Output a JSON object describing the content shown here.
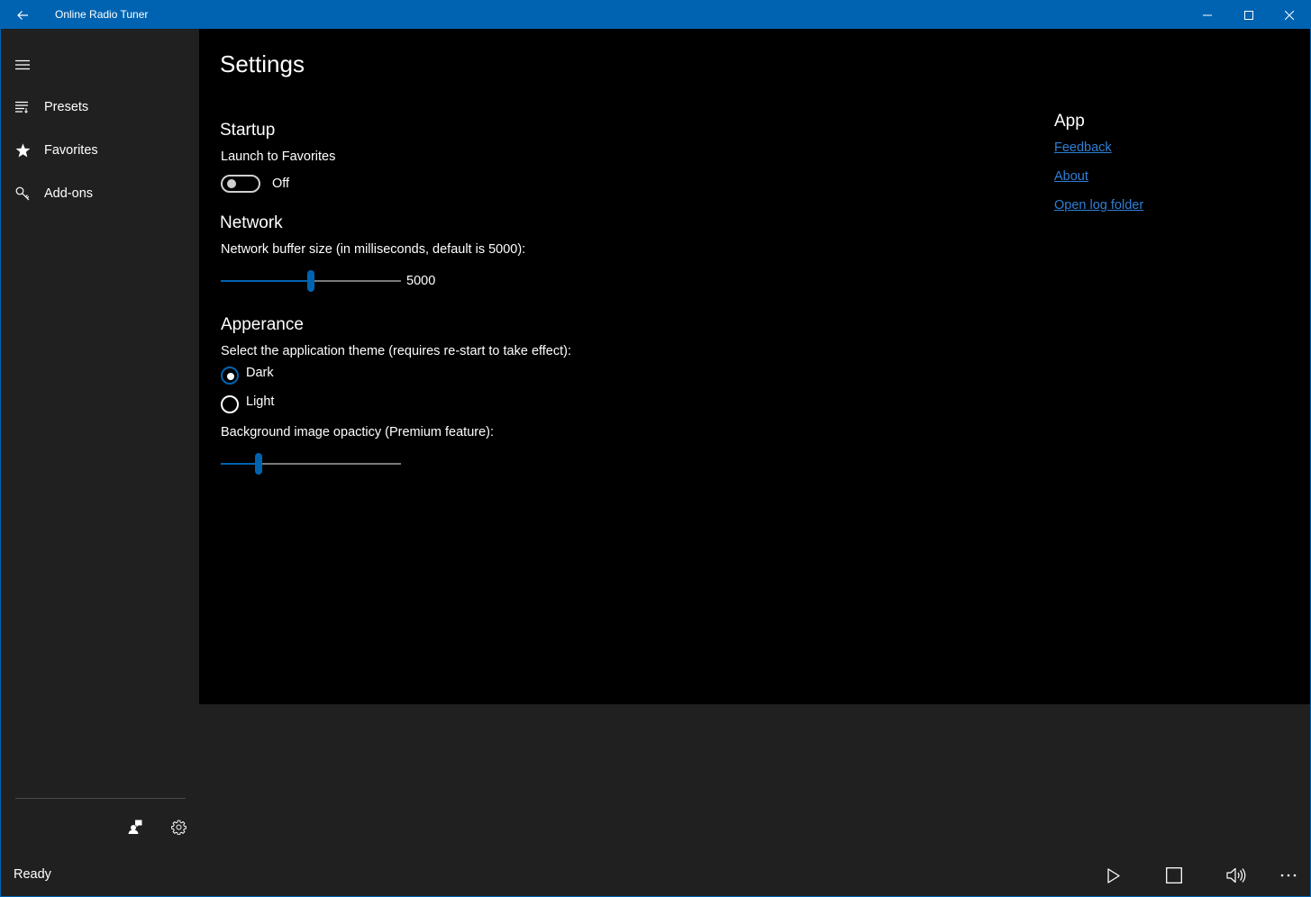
{
  "window": {
    "title": "Online Radio Tuner",
    "accent_color": "#0063b1"
  },
  "titlebar": {
    "back_icon": "back-arrow-icon",
    "minimize_icon": "minimize-icon",
    "maximize_icon": "maximize-icon",
    "close_icon": "close-icon"
  },
  "nav": {
    "menu_icon": "hamburger-icon",
    "items": [
      {
        "label": "Presets",
        "icon": "list-icon"
      },
      {
        "label": "Favorites",
        "icon": "star-icon"
      },
      {
        "label": "Add-ons",
        "icon": "key-icon"
      }
    ],
    "footer_icons": [
      "feedback-person-icon",
      "gear-icon"
    ]
  },
  "settings": {
    "title": "Settings",
    "startup": {
      "header": "Startup",
      "launch_label": "Launch to Favorites",
      "toggle_state": "Off",
      "toggle_on": false
    },
    "network": {
      "header": "Network",
      "buffer_label": "Network buffer size (in milliseconds, default is 5000):",
      "buffer_value": "5000",
      "buffer_fraction": 0.5
    },
    "appearance": {
      "header": "Apperance",
      "theme_label": "Select the application theme (requires re-start to take effect):",
      "themes": [
        {
          "label": "Dark",
          "checked": true
        },
        {
          "label": "Light",
          "checked": false
        }
      ],
      "opacity_label": "Background image opacticy (Premium feature):",
      "opacity_fraction": 0.21
    },
    "app": {
      "header": "App",
      "links": [
        "Feedback",
        "About",
        "Open log folder"
      ]
    }
  },
  "status": {
    "text": "Ready"
  },
  "player": {
    "icons": [
      "play-icon",
      "stop-icon",
      "volume-icon",
      "more-icon"
    ]
  }
}
